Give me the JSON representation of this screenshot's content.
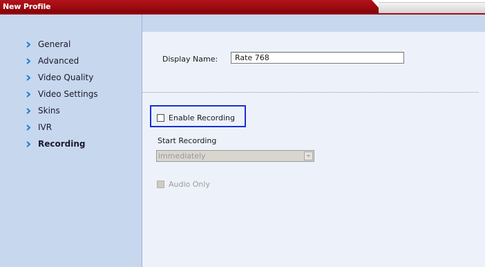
{
  "window": {
    "title": "New Profile"
  },
  "sidebar": {
    "items": [
      {
        "label": "General",
        "active": false
      },
      {
        "label": "Advanced",
        "active": false
      },
      {
        "label": "Video Quality",
        "active": false
      },
      {
        "label": "Video Settings",
        "active": false
      },
      {
        "label": "Skins",
        "active": false
      },
      {
        "label": "IVR",
        "active": false
      },
      {
        "label": "Recording",
        "active": true
      }
    ]
  },
  "main": {
    "display_name_label": "Display Name:",
    "display_name_value": "Rate 768",
    "enable_recording_label": "Enable Recording",
    "enable_recording_checked": false,
    "start_recording_label": "Start Recording",
    "start_recording_selected": "immediately",
    "audio_only_label": "Audio Only",
    "audio_only_checked": false
  },
  "colors": {
    "title_bar": "#9c0a10",
    "sidebar_bg": "#c7d7ee",
    "content_bg": "#edf2fa",
    "highlight_border": "#1b2fd6",
    "chevron": "#1f7fd0"
  }
}
